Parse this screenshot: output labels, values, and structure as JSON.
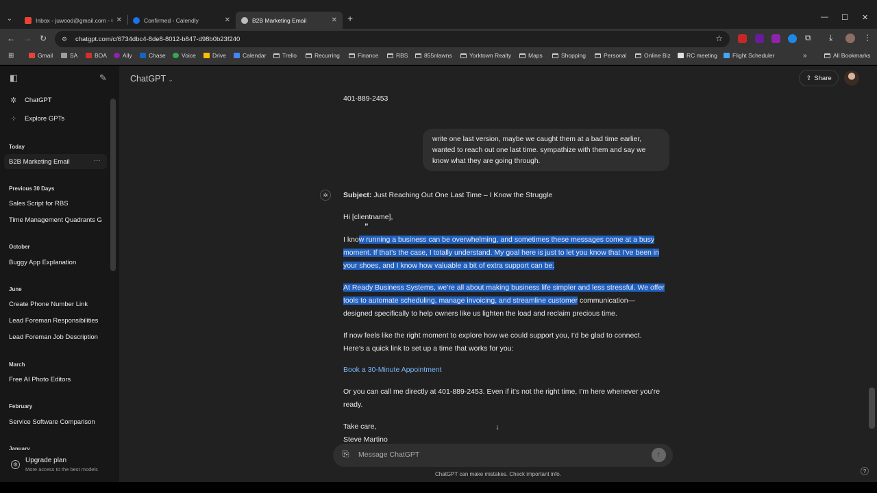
{
  "browser": {
    "tabs": [
      {
        "title": "Inbox - juwood@gmail.com - G",
        "favicon_color": "#ea4335"
      },
      {
        "title": "Confirmed - Calendly",
        "favicon_color": "#1a73e8"
      },
      {
        "title": "B2B Marketing Email",
        "favicon_color": "#bdbdbd"
      }
    ],
    "url": "chatgpt.com/c/6734dbc4-8de8-8012-b847-d98b0b23f240",
    "bookmarks": [
      {
        "label": "Gmail",
        "color": "#ea4335"
      },
      {
        "label": "SA",
        "color": "#9e9e9e"
      },
      {
        "label": "BOA",
        "color": "#d32f2f"
      },
      {
        "label": "Ally",
        "color": "#8e24aa"
      },
      {
        "label": "Chase",
        "color": "#1565c0"
      },
      {
        "label": "Voice",
        "color": "#34a853"
      },
      {
        "label": "Drive",
        "color": "#fbbc04"
      },
      {
        "label": "Calendar",
        "color": "#4285f4"
      },
      {
        "label": "Trello",
        "color": "folder"
      },
      {
        "label": "Recurring",
        "color": "folder"
      },
      {
        "label": "Finance",
        "color": "folder"
      },
      {
        "label": "RBS",
        "color": "folder"
      },
      {
        "label": "855nlawns",
        "color": "folder"
      },
      {
        "label": "Yorktown Realty",
        "color": "folder"
      },
      {
        "label": "Maps",
        "color": "folder"
      },
      {
        "label": "Shopping",
        "color": "folder"
      },
      {
        "label": "Personal",
        "color": "folder"
      },
      {
        "label": "Online Biz",
        "color": "folder"
      },
      {
        "label": "RC meeting",
        "color": "#e0e0e0"
      },
      {
        "label": "Flight Scheduler",
        "color": "#42a5f5"
      }
    ],
    "all_bookmarks": "All Bookmarks"
  },
  "sidebar": {
    "nav": [
      {
        "label": "ChatGPT",
        "icon": "openai-logo-icon"
      },
      {
        "label": "Explore GPTs",
        "icon": "grid-icon"
      }
    ],
    "sections": [
      {
        "title": "Today",
        "items": [
          "B2B Marketing Email"
        ]
      },
      {
        "title": "Previous 30 Days",
        "items": [
          "Sales Script for RBS",
          "Time Management Quadrants G"
        ]
      },
      {
        "title": "October",
        "items": [
          "Buggy App Explanation"
        ]
      },
      {
        "title": "June",
        "items": [
          "Create Phone Number Link",
          "Lead Foreman Responsibilities",
          "Lead Foreman Job Description"
        ]
      },
      {
        "title": "March",
        "items": [
          "Free AI Photo Editors"
        ]
      },
      {
        "title": "February",
        "items": [
          "Service Software Comparison"
        ]
      },
      {
        "title": "January",
        "items": []
      }
    ],
    "upgrade": {
      "title": "Upgrade plan",
      "subtitle": "More access to the best models"
    }
  },
  "main": {
    "model_label": "ChatGPT",
    "share_label": "Share",
    "prev_phone": "401-889-2453",
    "user_message": "write one last version, maybe we caught them at a bad time earlier, wanted to reach out one last time. sympathize with them and say we know what they are going through.",
    "assistant": {
      "subject_label": "Subject:",
      "subject": "Just Reaching Out One Last Time – I Know the Struggle",
      "greeting": "Hi [clientname],",
      "p1_pre": "I kno",
      "p1_line1_hl": "w running a business can be overwhelming, and sometimes these messages come at a busy",
      "p1_line2": "moment. If that’s the case, I totally understand. My goal here is just to let you know that I’ve been in",
      "p1_line3": "your shoes, and I know how valuable a bit of extra support can be.",
      "p2_line1": "At Ready Business Systems, we’re all about making business life simpler and less stressful. We offer",
      "p2_line2_hl": "tools to automate scheduling, manage invoicing, and streamline customer",
      "p2_line2_rest": " communication—",
      "p2_line3": "designed specifically to help owners like us lighten the load and reclaim precious time.",
      "p3_line1": "If now feels like the right moment to explore how we could support you, I’d be glad to connect.",
      "p3_line2": "Here’s a quick link to set up a time that works for you:",
      "link": "Book a 30-Minute Appointment",
      "p4_line1": "Or you can call me directly at 401-889-2453. Even if it’s not the right time, I’m here whenever you’re",
      "p4_line2": "ready.",
      "signoff": "Take care,",
      "name": "Steve Martino"
    },
    "composer_placeholder": "Message ChatGPT",
    "disclaimer": "ChatGPT can make mistakes. Check important info."
  },
  "colors": {
    "highlight": "#1f5fbf",
    "link": "#7ab7ff",
    "main_bg": "#212121",
    "sidebar_bg": "#171717"
  }
}
